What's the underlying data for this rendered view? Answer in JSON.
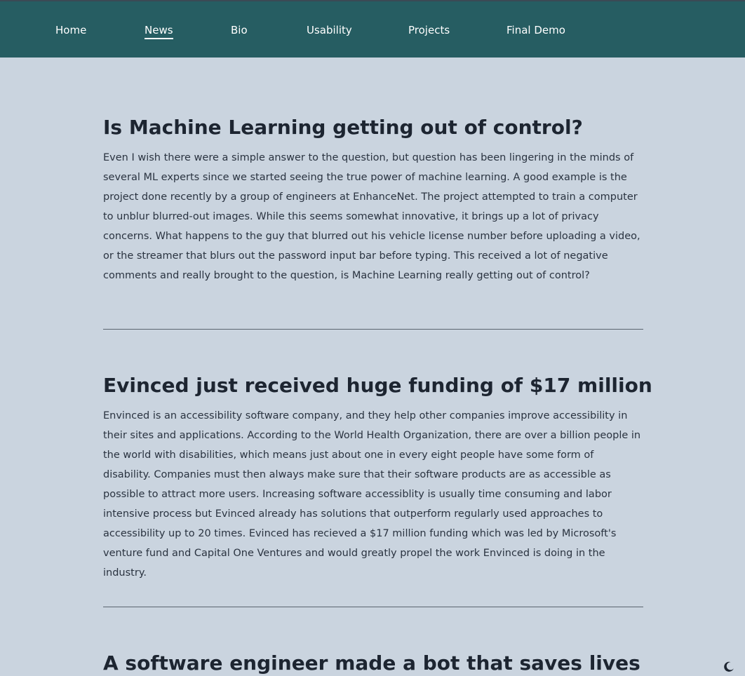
{
  "nav": {
    "items": [
      {
        "label": "Home",
        "active": false
      },
      {
        "label": "News",
        "active": true
      },
      {
        "label": "Bio",
        "active": false
      },
      {
        "label": "Usability",
        "active": false
      },
      {
        "label": "Projects",
        "active": false
      },
      {
        "label": "Final Demo",
        "active": false
      }
    ]
  },
  "articles": [
    {
      "title": "Is Machine Learning getting out of control?",
      "body": "Even I wish there were a simple answer to the question, but question has been lingering in the minds of several ML experts since we started seeing the true power of machine learning. A good example is the project done recently by a group of engineers at EnhanceNet. The project attempted to train a computer to unblur blurred-out images. While this seems somewhat innovative, it brings up a lot of privacy concerns. What happens to the guy that blurred out his vehicle license number before uploading a video, or the streamer that blurs out the password input bar before typing. This received a lot of negative comments and really brought to the question, is Machine Learning really getting out of control?"
    },
    {
      "title": "Evinced just received huge funding of $17 million",
      "body": "Envinced is an accessibility software company, and they help other companies improve accessibility in their sites and applications. According to the World Health Organization, there are over a billion people in the world with disabilities, which means just about one in every eight people have some form of disability. Companies must then always make sure that their software products are as accessible as possible to attract more users. Increasing software accessiblity is usually time consuming and labor intensive process but Evinced already has solutions that outperform regularly used approaches to accessibility up to 20 times. Evinced has recieved a $17 million funding which was led by Microsoft's venture fund and Capital One Ventures and would greatly propel the work Envinced is doing in the industry."
    },
    {
      "title": "A software engineer made a bot that saves lives",
      "body": ""
    }
  ],
  "theme_toggle": {
    "icon": "moon-icon"
  },
  "colors": {
    "nav_bg": "#265d62",
    "page_bg": "#cad4df",
    "nav_text": "#ffffff",
    "heading": "#1d2531"
  }
}
